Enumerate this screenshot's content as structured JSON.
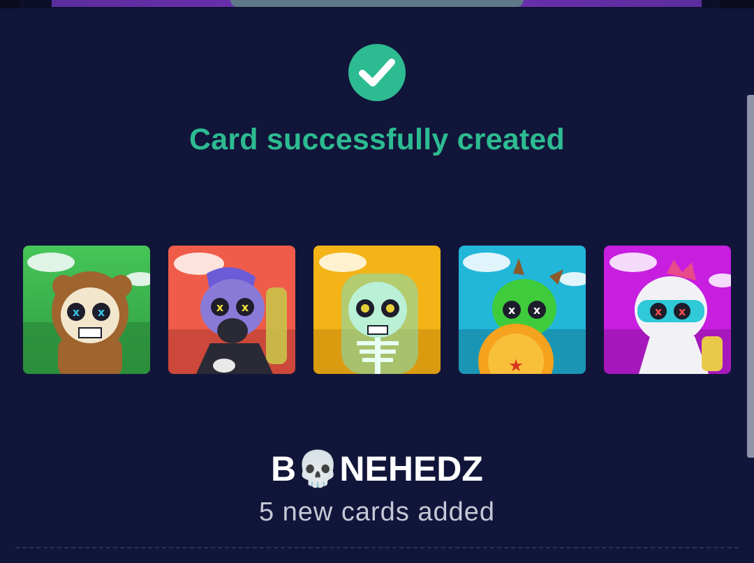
{
  "status": {
    "icon": "check-circle-icon",
    "message": "Card successfully created",
    "accent_color": "#2dbb91"
  },
  "cards": [
    {
      "icon": "skull-bear-costume-art",
      "bg": "#3fb84f"
    },
    {
      "icon": "skull-gas-mask-art",
      "bg": "#ee5a4a"
    },
    {
      "icon": "skeleton-ghost-art",
      "bg": "#f5b41a"
    },
    {
      "icon": "skull-dragon-costume-art",
      "bg": "#1fb4d8"
    },
    {
      "icon": "skull-dino-costume-art",
      "bg": "#c81ee0"
    }
  ],
  "collection": {
    "name": "B💀NEHEDZ",
    "summary": "5 new cards added"
  }
}
